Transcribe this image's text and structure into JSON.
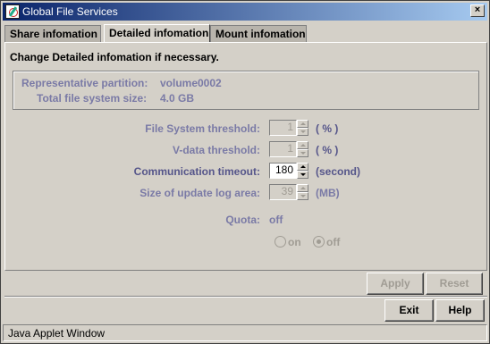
{
  "window": {
    "title": "Global File Services"
  },
  "tabs": [
    {
      "label": "Share infomation",
      "active": false
    },
    {
      "label": "Detailed infomation",
      "active": true
    },
    {
      "label": "Mount infomation",
      "active": false
    }
  ],
  "instruction": "Change Detailed infomation if necessary.",
  "info": {
    "partition_label": "Representative partition:",
    "partition_value": "volume0002",
    "size_label": "Total file system size:",
    "size_value": "4.0 GB"
  },
  "settings": {
    "fs_threshold": {
      "label": "File System threshold:",
      "value": "1",
      "unit": "( % )",
      "enabled": false
    },
    "vdata_threshold": {
      "label": "V-data threshold:",
      "value": "1",
      "unit": "( % )",
      "enabled": false
    },
    "comm_timeout": {
      "label": "Communication timeout:",
      "value": "180",
      "unit": "(second)",
      "enabled": true
    },
    "log_area": {
      "label": "Size of update log area:",
      "value": "39",
      "unit": "(MB)",
      "enabled": false
    },
    "quota": {
      "label": "Quota:",
      "value": "off",
      "options": [
        "on",
        "off"
      ],
      "selected": "off"
    }
  },
  "buttons": {
    "apply": "Apply",
    "reset": "Reset",
    "exit": "Exit",
    "help": "Help"
  },
  "status": "Java Applet Window",
  "colors": {
    "titlebar_start": "#0a246a",
    "titlebar_end": "#a6caf0",
    "label": "#55558a",
    "dim_label": "#7a7aa6"
  }
}
